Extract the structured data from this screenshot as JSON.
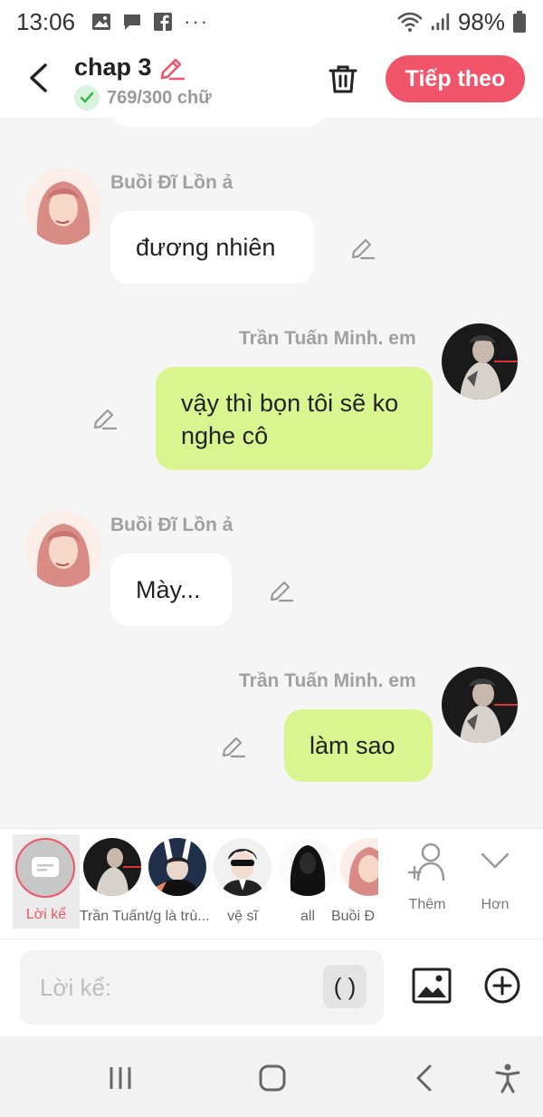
{
  "status": {
    "time": "13:06",
    "battery": "98%",
    "more_dots": "···"
  },
  "header": {
    "title": "chap 3",
    "word_count": "769/300 chữ",
    "next_label": "Tiếp theo"
  },
  "messages": [
    {
      "side": "left",
      "sender": "Buồi Đĩ Lồn ả",
      "text": "đương nhiên"
    },
    {
      "side": "right",
      "sender": "Trần Tuấn Minh. em",
      "text": "vậy thì bọn tôi sẽ ko nghe cô"
    },
    {
      "side": "left",
      "sender": "Buồi Đĩ Lồn ả",
      "text": "Mày..."
    },
    {
      "side": "right",
      "sender": "Trần Tuấn Minh. em",
      "text": "làm sao"
    }
  ],
  "characters": {
    "narrator_label": "Lời kể",
    "items": [
      {
        "label": "Trần Tuấn"
      },
      {
        "label": "t/g là trù..."
      },
      {
        "label": "vệ sĩ"
      },
      {
        "label": "all"
      },
      {
        "label": "Buồi Đ"
      }
    ],
    "add_label": "Thêm",
    "more_label": "Hơn"
  },
  "composer": {
    "placeholder": "Lời kể:",
    "paren_label": "( )"
  },
  "colors": {
    "accent": "#f2546a",
    "green_bubble": "#d8f58f",
    "white_bubble": "#ffffff"
  }
}
